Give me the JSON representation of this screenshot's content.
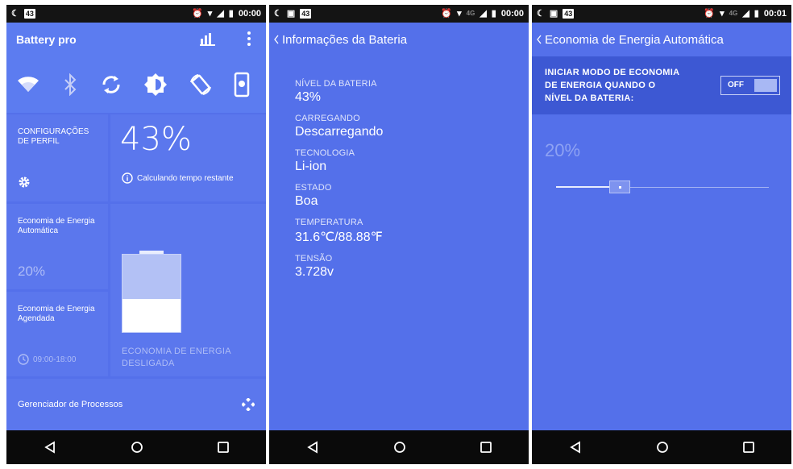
{
  "screen1": {
    "status": {
      "notif_count": "43",
      "time": "00:00"
    },
    "app_title": "Battery pro",
    "toggles": [
      "wifi-icon",
      "bluetooth-icon",
      "sync-icon",
      "brightness-icon",
      "rotation-icon",
      "timeout-icon"
    ],
    "profile_label_1": "CONFIGURAÇÕES",
    "profile_label_2": "DE PERFIL",
    "battery_percent": "43%",
    "battery_level": 0.43,
    "calculating": "Calculando tempo restante",
    "auto_eco_1": "Economia de Energia",
    "auto_eco_2": "Automática",
    "auto_eco_value": "20%",
    "sched_eco_1": "Economia de Energia",
    "sched_eco_2": "Agendada",
    "sched_time": "09:00-18:00",
    "eco_off_1": "ECONOMIA DE ENERGIA",
    "eco_off_2": "DESLIGADA",
    "process_manager": "Gerenciador de Processos"
  },
  "screen2": {
    "status": {
      "notif_count": "43",
      "network": "4G",
      "time": "00:00"
    },
    "title": "Informações da Bateria",
    "items": [
      {
        "label": "NÍVEL DA BATERIA",
        "value": "43%"
      },
      {
        "label": "CARREGANDO",
        "value": "Descarregando"
      },
      {
        "label": "TECNOLOGIA",
        "value": "Li-ion"
      },
      {
        "label": "ESTADO",
        "value": "Boa"
      },
      {
        "label": "TEMPERATURA",
        "value": "31.6℃/88.88℉"
      },
      {
        "label": "TENSÃO",
        "value": "3.728v"
      }
    ]
  },
  "screen3": {
    "status": {
      "notif_count": "43",
      "network": "4G",
      "time": "00:01"
    },
    "title": "Economia de Energia Automática",
    "eco_line_1": "INICIAR MODO DE ECONOMIA",
    "eco_line_2": "DE ENERGIA QUANDO O",
    "eco_line_3": "NÍVEL DA BATERIA:",
    "switch_label": "OFF",
    "slider_value": "20%",
    "slider_fraction": 0.3
  },
  "colors": {
    "panel_bg": "#5470ea",
    "tile_bg": "#5b77ed",
    "band_bg": "#3d58d3",
    "navbar": "#0a0a0a"
  }
}
